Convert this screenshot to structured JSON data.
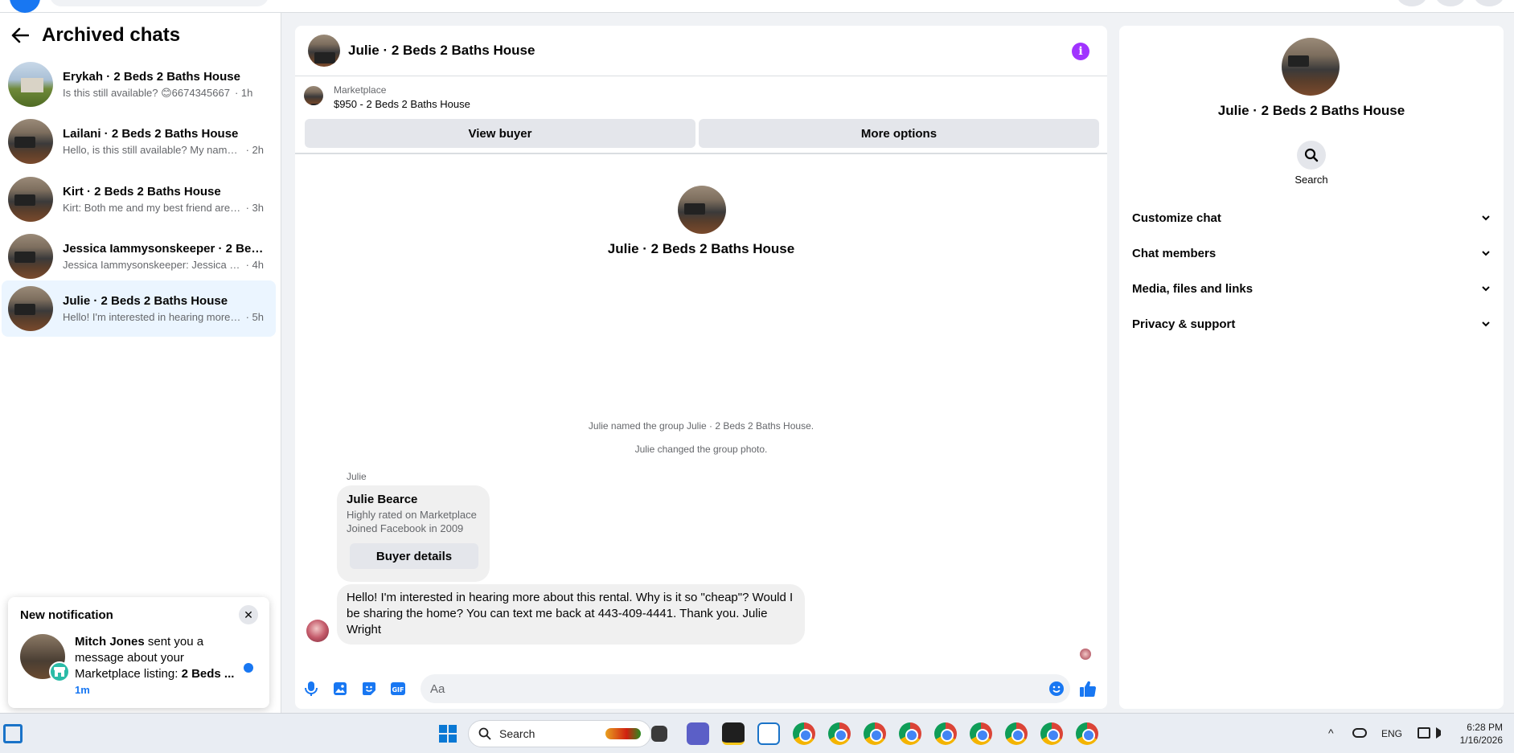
{
  "sidebar": {
    "title": "Archived chats",
    "chats": [
      {
        "name": "Erykah · 2 Beds 2 Baths House",
        "preview": "Is this still available? 😊6674345667",
        "time": "· 1h"
      },
      {
        "name": "Lailani · 2 Beds 2 Baths House",
        "preview": "Hello, is this still available? My name i...",
        "time": "· 2h"
      },
      {
        "name": "Kirt · 2 Beds 2 Baths House",
        "preview": "Kirt: Both me and my best friend are d...",
        "time": "· 3h"
      },
      {
        "name": "Jessica Iammysonskeeper · 2 Beds ...",
        "preview": "Jessica Iammysonskeeper: Jessica Ma...",
        "time": "· 4h"
      },
      {
        "name": "Julie · 2 Beds 2 Baths House",
        "preview": "Hello! I'm interested in hearing more ...",
        "time": "· 5h"
      }
    ]
  },
  "notification": {
    "title": "New notification",
    "sender": "Mitch Jones",
    "text": " sent you a message about your Marketplace listing: ",
    "listing": "2 Beds ...",
    "time": "1m"
  },
  "conversation": {
    "header_title": "Julie · 2 Beds 2 Baths House",
    "marketplace_label": "Marketplace",
    "listing": "$950 - 2 Beds 2 Baths House",
    "view_buyer": "View buyer",
    "more_options": "More options",
    "title": "Julie · 2 Beds 2 Baths House",
    "system_messages": [
      "Julie named the group Julie · 2 Beds 2 Baths House.",
      "Julie changed the group photo."
    ],
    "sender": "Julie",
    "buyer_card": {
      "name": "Julie Bearce",
      "line1": "Highly rated on Marketplace",
      "line2": "Joined Facebook in 2009",
      "button": "Buyer details"
    },
    "message": "Hello! I'm interested in hearing more about this rental.  Why is it so \"cheap\"? Would I be sharing the home? You can text me back at 443-409-4441. Thank you.  Julie Wright",
    "composer_placeholder": "Aa"
  },
  "info_panel": {
    "name": "Julie · 2 Beds 2 Baths House",
    "search_label": "Search",
    "sections": [
      "Customize chat",
      "Chat members",
      "Media, files and links",
      "Privacy & support"
    ]
  },
  "taskbar": {
    "search_label": "Search",
    "language": "ENG",
    "time": "6:28 PM",
    "date": "1/16/2026"
  },
  "colors": {
    "accent": "#1877f2",
    "info": "#a033ff",
    "active_chat": "#ebf5ff"
  }
}
